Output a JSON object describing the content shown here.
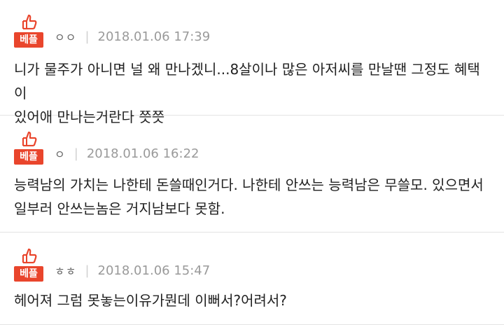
{
  "comments": [
    {
      "badge": "베플",
      "user": "ㅇㅇ",
      "date": "2018.01.06 17:39",
      "text": "니가 물주가 아니면 널 왜 만나겠니...8살이나 많은 아저씨를 만날땐 그정도 혜택이\n있어애 만나는거란다 쯧쯧"
    },
    {
      "badge": "베플",
      "user": "ㅇ",
      "date": "2018.01.06 16:22",
      "text": "능력남의 가치는 나한테 돈쓸때인거다. 나한테 안쓰는 능력남은 무쓸모. 있으면서\n일부러 안쓰는놈은 거지남보다 못함."
    },
    {
      "badge": "베플",
      "user": "ㅎㅎ",
      "date": "2018.01.06 15:47",
      "text": "헤어져 그럼 못놓는이유가뭔데 이뻐서?어려서?"
    }
  ],
  "colors": {
    "badge": "#e9452c",
    "divider": "#e3e3e3",
    "meta": "#9a9a9a"
  }
}
